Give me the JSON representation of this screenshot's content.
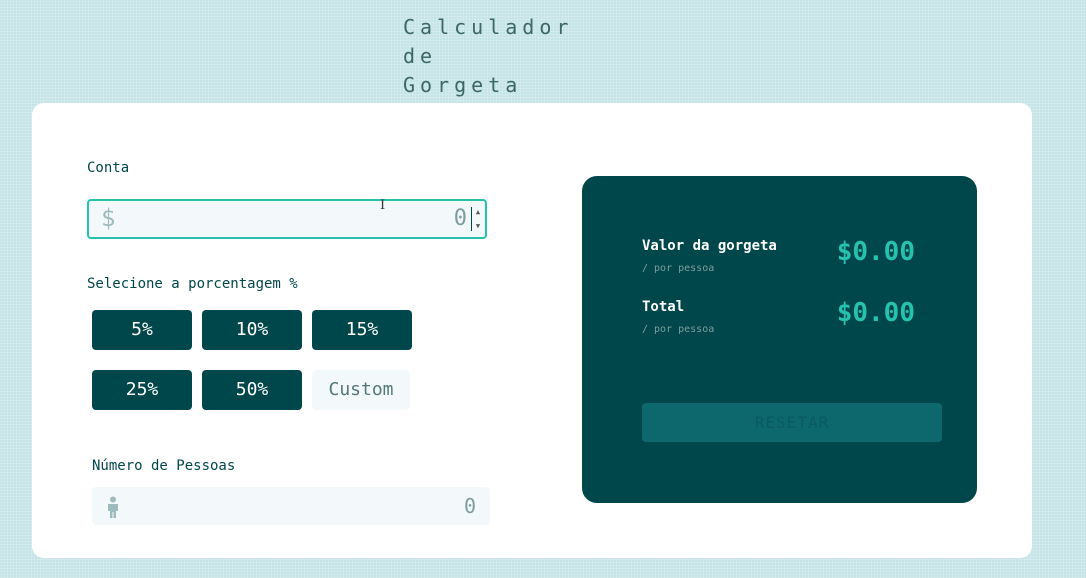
{
  "app": {
    "title_line1": "Calculador",
    "title_line2": "de",
    "title_line3": "Gorgeta"
  },
  "bill": {
    "label": "Conta",
    "currency_symbol": "$",
    "value": "0"
  },
  "tip": {
    "label": "Selecione a porcentagem %",
    "options": [
      "5%",
      "10%",
      "15%",
      "25%",
      "50%"
    ],
    "custom_placeholder": "Custom"
  },
  "people": {
    "label": "Número de Pessoas",
    "value": "0",
    "icon": "person-icon"
  },
  "result": {
    "tip_label": "Valor da gorgeta",
    "tip_sub": "/ por pessoa",
    "tip_amount": "$0.00",
    "total_label": "Total",
    "total_sub": "/ por pessoa",
    "total_amount": "$0.00",
    "reset_label": "RESETAR"
  },
  "colors": {
    "accent": "#26c2ae",
    "dark": "#00474b",
    "background": "#c5e4e7"
  }
}
